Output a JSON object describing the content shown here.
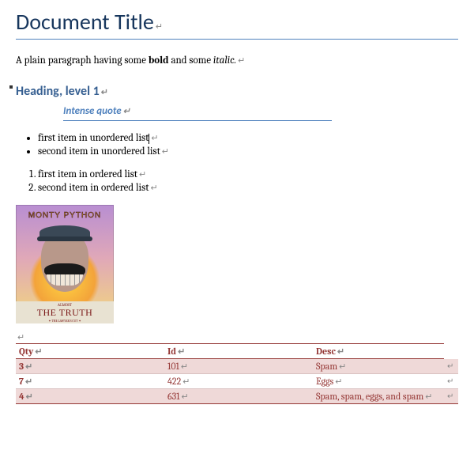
{
  "title": "Document Title",
  "paragraph": {
    "t1": "A plain paragraph having some ",
    "bold": "bold",
    "t2": " and some ",
    "italic": "italic.",
    "t3": ""
  },
  "heading1": "Heading, level 1",
  "quote": "Intense quote",
  "ul": [
    "first item in unordered list",
    "second item in unordered list"
  ],
  "ol": [
    "first item in ordered list",
    "second item in ordered list"
  ],
  "image": {
    "banner": "MONTY PYTHON",
    "small": "ALMOST",
    "big": "THE TRUTH",
    "tiny": "✦ THE LAWYER'S CUT ✦"
  },
  "table": {
    "headers": [
      "Qty",
      "Id",
      "Desc"
    ],
    "rows": [
      {
        "qty": "3",
        "id": "101",
        "desc": "Spam"
      },
      {
        "qty": "7",
        "id": "422",
        "desc": "Eggs"
      },
      {
        "qty": "4",
        "id": "631",
        "desc": "Spam, spam, eggs, and spam"
      }
    ]
  },
  "mark": "↵"
}
